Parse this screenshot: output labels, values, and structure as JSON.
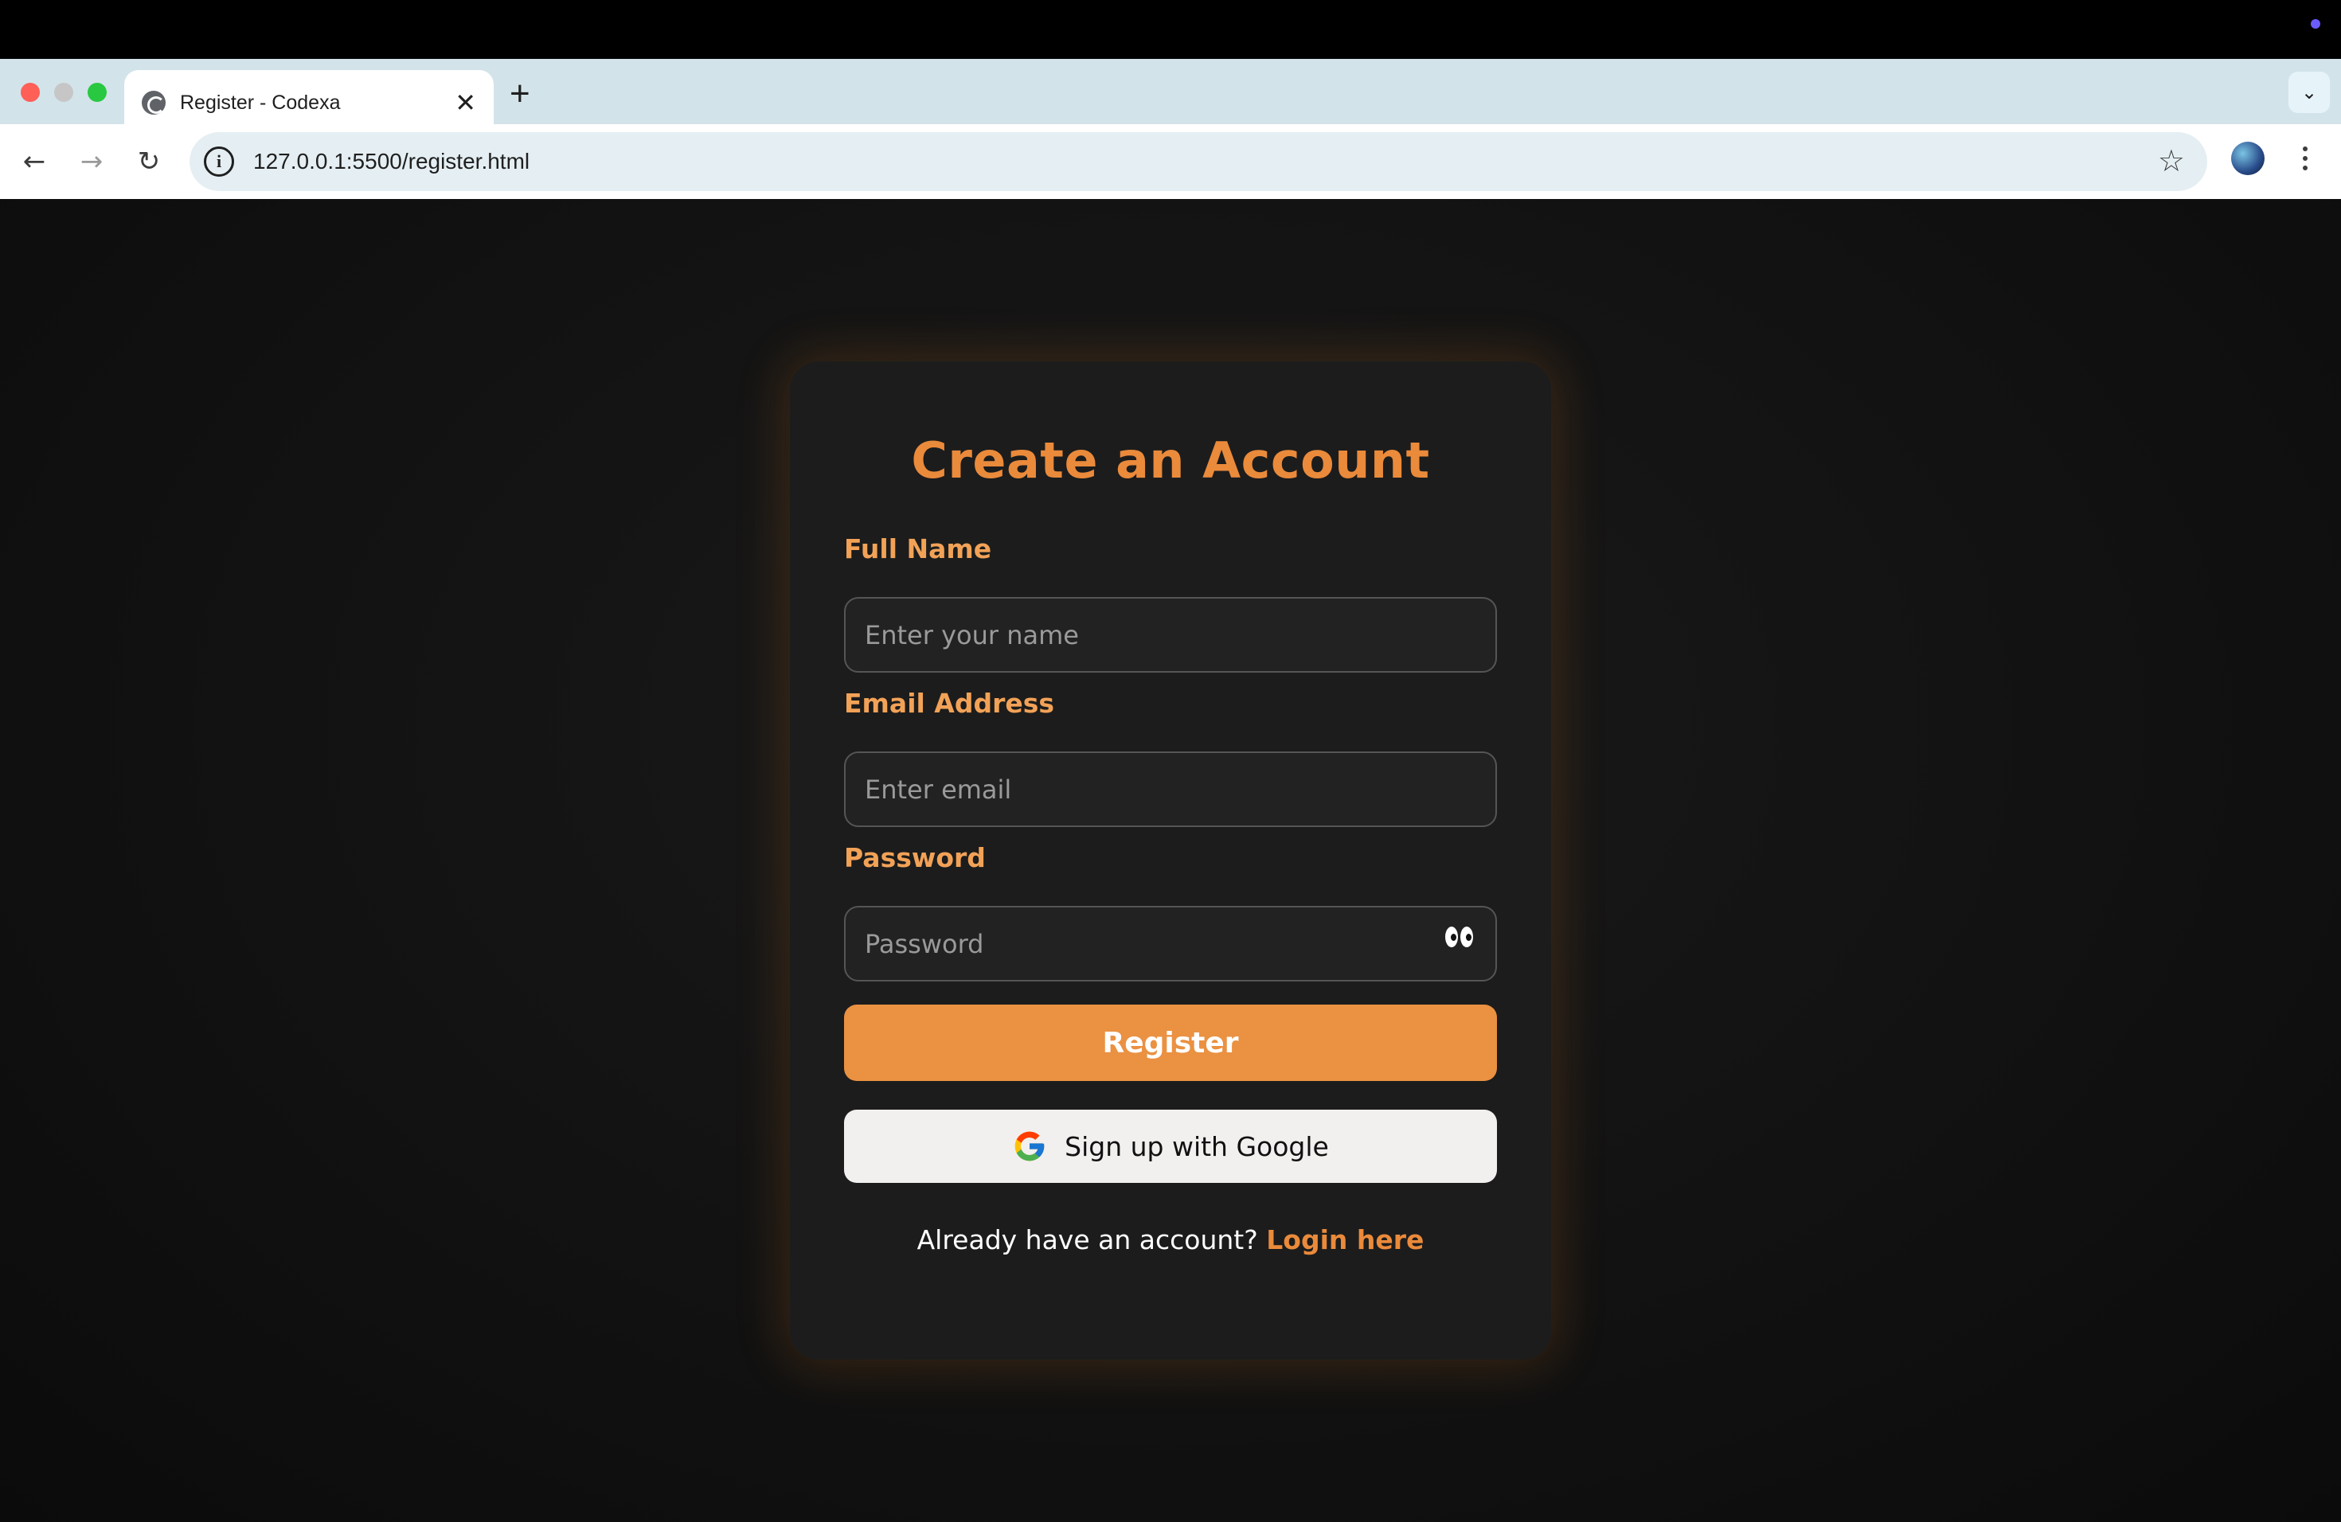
{
  "browser": {
    "tab_title": "Register - Codexa",
    "tab_close": "✕",
    "new_tab": "+",
    "url": "127.0.0.1:5500/register.html"
  },
  "form": {
    "title": "Create an Account",
    "fields": [
      {
        "label": "Full Name",
        "placeholder": "Enter your name",
        "value": ""
      },
      {
        "label": "Email Address",
        "placeholder": "Enter email",
        "value": ""
      },
      {
        "label": "Password",
        "placeholder": "Password",
        "value": ""
      }
    ],
    "register_label": "Register",
    "google_label": "Sign up with Google",
    "footer_prompt": "Already have an account?",
    "footer_link": "Login here"
  },
  "colors": {
    "accent": "#ea8a3b",
    "label": "#f2a257",
    "button": "#ea9142",
    "card": "#1c1c1c",
    "google_button": "#f2efef"
  },
  "icons": [
    "globe-icon",
    "close-icon",
    "plus-icon",
    "chevron-down-icon",
    "back-arrow-icon",
    "forward-arrow-icon",
    "reload-icon",
    "site-info-icon",
    "star-icon",
    "avatar",
    "more-vert-icon",
    "eye-icon",
    "google-icon"
  ]
}
